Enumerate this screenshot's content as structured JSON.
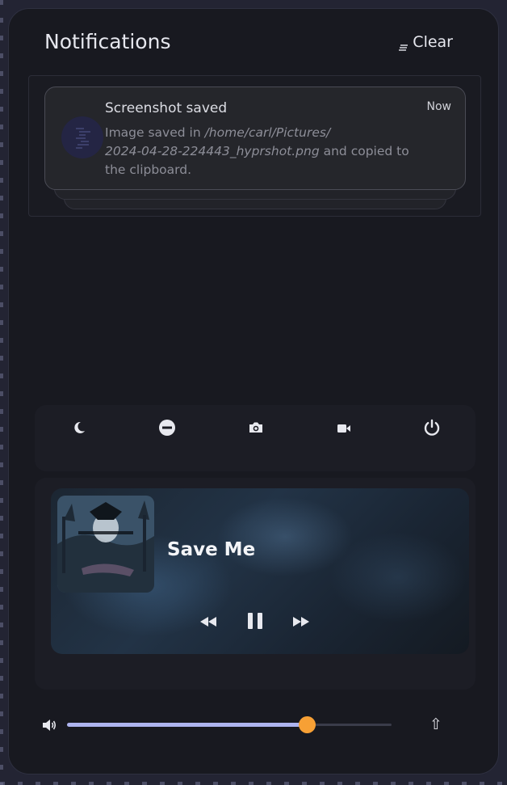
{
  "header": {
    "title": "Notifications",
    "clear_label": "Clear",
    "clear_icon": "clear-all-icon"
  },
  "notification": {
    "title": "Screenshot saved",
    "time": "Now",
    "body_prefix": "Image saved in ",
    "body_path_line1": "/home/carl/Pictures/",
    "body_path_line2": "2024-04-28-224443_hyprshot.png",
    "body_suffix": " and copied to the clipboard.",
    "app_icon": "screenshot-app-icon"
  },
  "quick_controls": [
    {
      "name": "do-not-disturb",
      "icon": "moon-icon"
    },
    {
      "name": "mute",
      "icon": "minus-circle-icon"
    },
    {
      "name": "screenshot",
      "icon": "camera-icon"
    },
    {
      "name": "screen-record",
      "icon": "video-camera-icon"
    },
    {
      "name": "power",
      "icon": "power-icon"
    }
  ],
  "media": {
    "title": "Save Me",
    "controls": [
      "previous-icon",
      "pause-icon",
      "next-icon"
    ]
  },
  "volume": {
    "icon": "speaker-icon",
    "level": 0.74,
    "expand_icon": "arrow-up-icon",
    "expand_glyph": "⇧"
  },
  "colors": {
    "accent": "#aeb4ef",
    "thumb": "#f7a035",
    "panel_bg": "#181920"
  }
}
